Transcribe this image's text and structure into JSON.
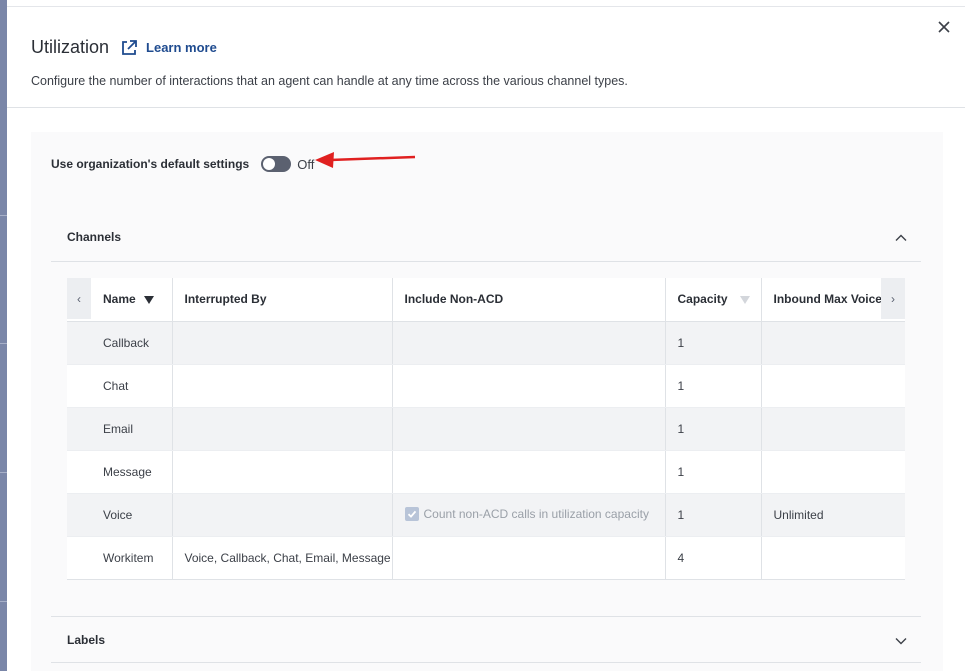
{
  "header": {
    "title": "Utilization",
    "learn_more": "Learn more",
    "subtitle": "Configure the number of interactions that an agent can handle at any time across the various channel types."
  },
  "default_settings": {
    "label": "Use organization's default settings",
    "state": "Off",
    "enabled": false
  },
  "channels": {
    "label": "Channels",
    "columns": [
      "Name",
      "Interrupted By",
      "Include Non-ACD",
      "Capacity",
      "Inbound Max Voice"
    ],
    "rows": [
      {
        "name": "Callback",
        "interrupted_by": "",
        "include_non_acd": "",
        "capacity": "1",
        "inbound_max_voice": ""
      },
      {
        "name": "Chat",
        "interrupted_by": "",
        "include_non_acd": "",
        "capacity": "1",
        "inbound_max_voice": ""
      },
      {
        "name": "Email",
        "interrupted_by": "",
        "include_non_acd": "",
        "capacity": "1",
        "inbound_max_voice": ""
      },
      {
        "name": "Message",
        "interrupted_by": "",
        "include_non_acd": "",
        "capacity": "1",
        "inbound_max_voice": ""
      },
      {
        "name": "Voice",
        "interrupted_by": "",
        "include_non_acd": "Count non-ACD calls in utilization capacity",
        "capacity": "1",
        "inbound_max_voice": "Unlimited"
      },
      {
        "name": "Workitem",
        "interrupted_by": "Voice, Callback, Chat, Email, Message",
        "include_non_acd": "",
        "capacity": "4",
        "inbound_max_voice": ""
      }
    ]
  },
  "labels_section": {
    "label": "Labels"
  },
  "colors": {
    "link": "#1f4b8f",
    "annotation_arrow": "#e02020",
    "toggle_off": "#5b6170"
  }
}
